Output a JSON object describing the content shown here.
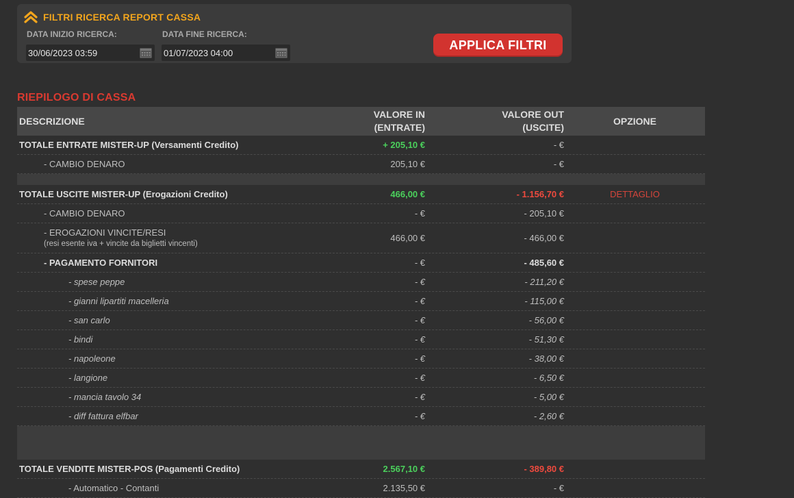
{
  "filters": {
    "title": "FILTRI RICERCA REPORT CASSA",
    "start_label": "DATA INIZIO RICERCA:",
    "start_value": "30/06/2023 03:59",
    "end_label": "DATA FINE RICERCA:",
    "end_value": "01/07/2023 04:00",
    "apply_label": "APPLICA FILTRI"
  },
  "summary": {
    "title": "RIEPILOGO DI CASSA",
    "headers": {
      "desc": "DESCRIZIONE",
      "in_line1": "VALORE IN",
      "in_line2": "(ENTRATE)",
      "out_line1": "VALORE OUT",
      "out_line2": "(USCITE)",
      "option": "OPZIONE"
    },
    "rows": [
      {
        "desc": "TOTALE ENTRATE MISTER-UP (Versamenti Credito)",
        "in": "+ 205,10 €",
        "out": "-  €"
      },
      {
        "desc": "- CAMBIO DENARO",
        "in": "205,10 €",
        "out": "-  €"
      },
      {
        "desc": "TOTALE USCITE MISTER-UP (Erogazioni Credito)",
        "in": "466,00 €",
        "out": "- 1.156,70 €",
        "option": "DETTAGLIO"
      },
      {
        "desc": "- CAMBIO DENARO",
        "in": "-  €",
        "out": "- 205,10 €"
      },
      {
        "desc": "- EROGAZIONI VINCITE/RESI",
        "sub": "(resi esente iva + vincite da biglietti vincenti)",
        "in": "466,00 €",
        "out": "- 466,00 €"
      },
      {
        "desc": "- PAGAMENTO FORNITORI",
        "in": "-  €",
        "out": "- 485,60 €"
      },
      {
        "desc": "- spese peppe",
        "in": "-  €",
        "out": "- 211,20 €"
      },
      {
        "desc": "- gianni lipartiti macelleria",
        "in": "-  €",
        "out": "- 115,00 €"
      },
      {
        "desc": "- san carlo",
        "in": "-  €",
        "out": "- 56,00 €"
      },
      {
        "desc": "- bindi",
        "in": "-  €",
        "out": "- 51,30 €"
      },
      {
        "desc": "- napoleone",
        "in": "-  €",
        "out": "- 38,00 €"
      },
      {
        "desc": "- langione",
        "in": "-  €",
        "out": "- 6,50 €"
      },
      {
        "desc": "- mancia tavolo 34",
        "in": "-  €",
        "out": "- 5,00 €"
      },
      {
        "desc": "- diff fattura elfbar",
        "in": "-  €",
        "out": "- 2,60 €"
      },
      {
        "desc": "TOTALE VENDITE MISTER-POS (Pagamenti Credito)",
        "in": "2.567,10 €",
        "out": "- 389,80 €"
      },
      {
        "desc": "- Automatico - Contanti",
        "in": "2.135,50 €",
        "out": "-  €"
      }
    ]
  },
  "colors": {
    "background": "#2f2f2f",
    "panel": "#3b3b3b",
    "accent_orange": "#f2a51d",
    "button_red": "#d2332f",
    "positive_green": "#4bd15c",
    "negative_red": "#ef4a3e"
  },
  "icons": {
    "collapse": "chevron-double-up-icon",
    "calendar": "calendar-icon"
  }
}
